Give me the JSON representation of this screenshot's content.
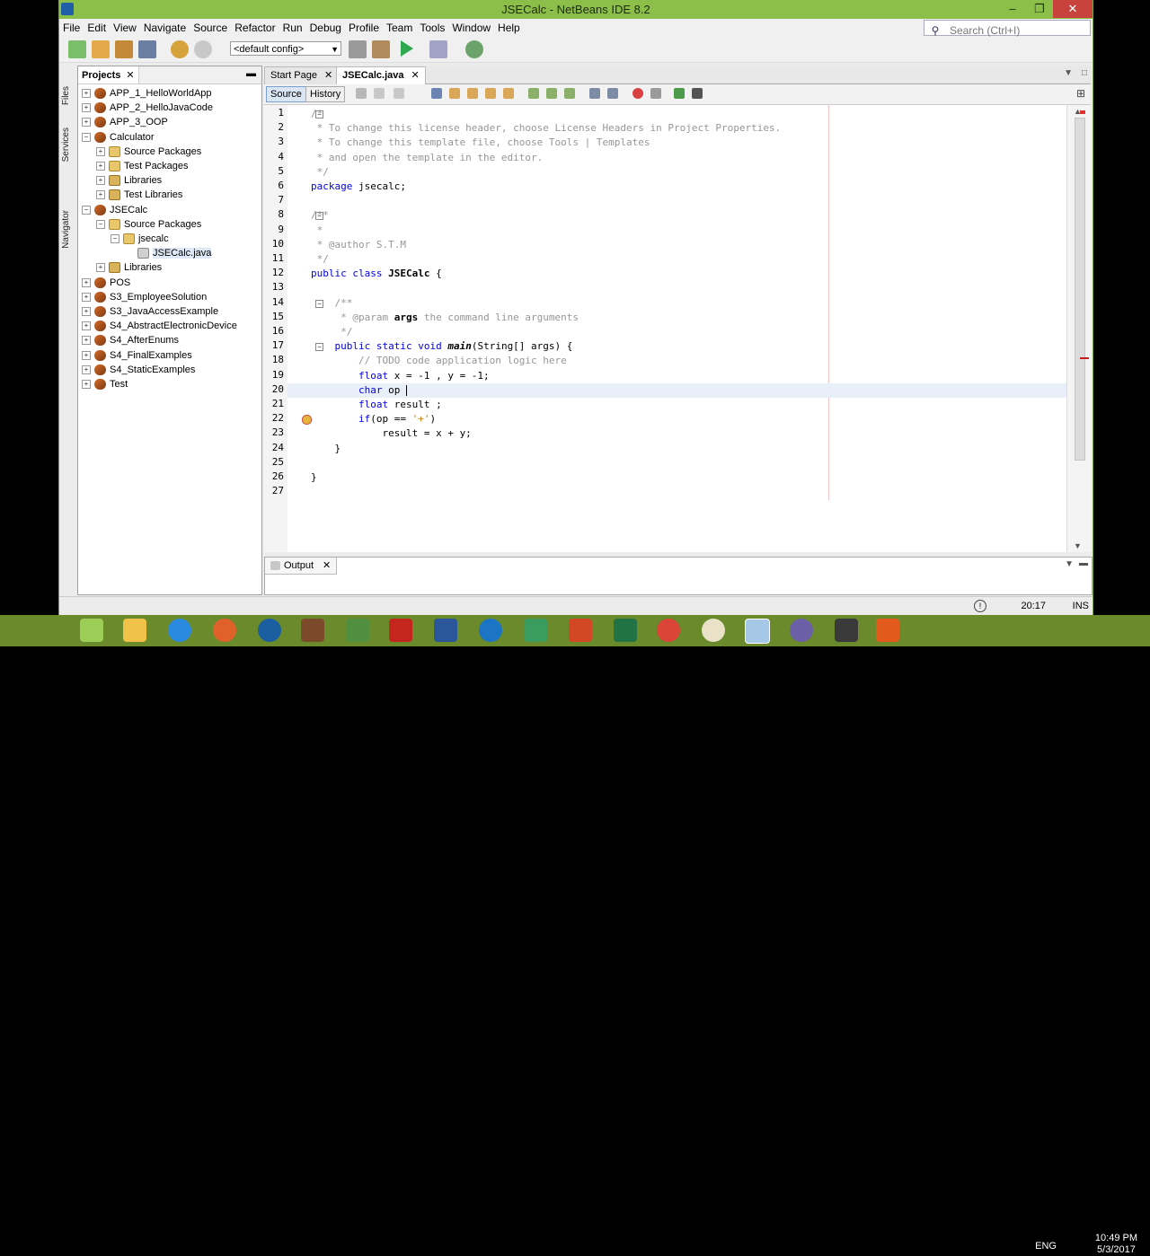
{
  "window": {
    "title": "JSECalc - NetBeans IDE 8.2",
    "controls": [
      "–",
      "❐",
      "✕"
    ]
  },
  "menu": {
    "items": [
      "File",
      "Edit",
      "View",
      "Navigate",
      "Source",
      "Refactor",
      "Run",
      "Debug",
      "Profile",
      "Team",
      "Tools",
      "Window",
      "Help"
    ],
    "search_placeholder": "Search (Ctrl+I)"
  },
  "toolbar": {
    "config_value": "<default config>"
  },
  "side_tabs": [
    "Files",
    "Services",
    "Navigator"
  ],
  "projects": {
    "tab_label": "Projects",
    "tree": [
      {
        "label": "APP_1_HelloWorldApp",
        "level": 0,
        "exp": "+",
        "icon": "proj"
      },
      {
        "label": "APP_2_HelloJavaCode",
        "level": 0,
        "exp": "+",
        "icon": "proj"
      },
      {
        "label": "APP_3_OOP",
        "level": 0,
        "exp": "+",
        "icon": "proj"
      },
      {
        "label": "Calculator",
        "level": 0,
        "exp": "−",
        "icon": "proj"
      },
      {
        "label": "Source Packages",
        "level": 1,
        "exp": "+",
        "icon": "pkg"
      },
      {
        "label": "Test Packages",
        "level": 1,
        "exp": "+",
        "icon": "pkg"
      },
      {
        "label": "Libraries",
        "level": 1,
        "exp": "+",
        "icon": "lib"
      },
      {
        "label": "Test Libraries",
        "level": 1,
        "exp": "+",
        "icon": "lib"
      },
      {
        "label": "JSECalc",
        "level": 0,
        "exp": "−",
        "icon": "proj"
      },
      {
        "label": "Source Packages",
        "level": 1,
        "exp": "−",
        "icon": "pkg"
      },
      {
        "label": "jsecalc",
        "level": 2,
        "exp": "−",
        "icon": "pkg"
      },
      {
        "label": "JSECalc.java",
        "level": 3,
        "exp": "",
        "icon": "java",
        "selected": true
      },
      {
        "label": "Libraries",
        "level": 1,
        "exp": "+",
        "icon": "lib"
      },
      {
        "label": "POS",
        "level": 0,
        "exp": "+",
        "icon": "proj"
      },
      {
        "label": "S3_EmployeeSolution",
        "level": 0,
        "exp": "+",
        "icon": "proj"
      },
      {
        "label": "S3_JavaAccessExample",
        "level": 0,
        "exp": "+",
        "icon": "proj"
      },
      {
        "label": "S4_AbstractElectronicDevice",
        "level": 0,
        "exp": "+",
        "icon": "proj"
      },
      {
        "label": "S4_AfterEnums",
        "level": 0,
        "exp": "+",
        "icon": "proj"
      },
      {
        "label": "S4_FinalExamples",
        "level": 0,
        "exp": "+",
        "icon": "proj"
      },
      {
        "label": "S4_StaticExamples",
        "level": 0,
        "exp": "+",
        "icon": "proj"
      },
      {
        "label": "Test",
        "level": 0,
        "exp": "+",
        "icon": "proj"
      }
    ]
  },
  "editor": {
    "tabs": [
      {
        "label": "Start Page",
        "active": false
      },
      {
        "label": "JSECalc.java",
        "active": true
      }
    ],
    "source_label": "Source",
    "history_label": "History",
    "lines": [
      {
        "n": "1",
        "fold": true,
        "parts": [
          {
            "t": "/*",
            "c": "cm"
          }
        ]
      },
      {
        "n": "2",
        "parts": [
          {
            "t": " * To change this license header, choose License Headers in Project Properties.",
            "c": "cm"
          }
        ]
      },
      {
        "n": "3",
        "parts": [
          {
            "t": " * To change this template file, choose Tools | Templates",
            "c": "cm"
          }
        ]
      },
      {
        "n": "4",
        "parts": [
          {
            "t": " * and open the template in the editor.",
            "c": "cm"
          }
        ]
      },
      {
        "n": "5",
        "parts": [
          {
            "t": " */",
            "c": "cm"
          }
        ]
      },
      {
        "n": "6",
        "parts": [
          {
            "t": "package",
            "c": "kw"
          },
          {
            "t": " jsecalc;",
            "c": ""
          }
        ]
      },
      {
        "n": "7",
        "parts": []
      },
      {
        "n": "8",
        "fold": true,
        "parts": [
          {
            "t": "/**",
            "c": "cm"
          }
        ]
      },
      {
        "n": "9",
        "parts": [
          {
            "t": " *",
            "c": "cm"
          }
        ]
      },
      {
        "n": "10",
        "parts": [
          {
            "t": " * @author S.T.M",
            "c": "cm"
          }
        ]
      },
      {
        "n": "11",
        "parts": [
          {
            "t": " */",
            "c": "cm"
          }
        ]
      },
      {
        "n": "12",
        "parts": [
          {
            "t": "public class",
            "c": "kw"
          },
          {
            "t": " ",
            "c": ""
          },
          {
            "t": "JSECalc",
            "c": "bold"
          },
          {
            "t": " {",
            "c": ""
          }
        ]
      },
      {
        "n": "13",
        "parts": []
      },
      {
        "n": "14",
        "fold": true,
        "parts": [
          {
            "t": "    /**",
            "c": "cm"
          }
        ]
      },
      {
        "n": "15",
        "parts": [
          {
            "t": "     * @param ",
            "c": "cm"
          },
          {
            "t": "args",
            "c": "bold"
          },
          {
            "t": " the command line arguments",
            "c": "cm"
          }
        ]
      },
      {
        "n": "16",
        "parts": [
          {
            "t": "     */",
            "c": "cm"
          }
        ]
      },
      {
        "n": "17",
        "fold": true,
        "parts": [
          {
            "t": "    public static void",
            "c": "kw"
          },
          {
            "t": " ",
            "c": ""
          },
          {
            "t": "main",
            "c": "bold it"
          },
          {
            "t": "(String[] args) {",
            "c": ""
          }
        ]
      },
      {
        "n": "18",
        "parts": [
          {
            "t": "        // TODO code application logic here",
            "c": "cm"
          }
        ]
      },
      {
        "n": "19",
        "parts": [
          {
            "t": "        float",
            "c": "kw"
          },
          {
            "t": " x = -1 , y = -1;",
            "c": ""
          }
        ]
      },
      {
        "n": "20",
        "caret": true,
        "parts": [
          {
            "t": "        char",
            "c": "kw"
          },
          {
            "t": " op ",
            "c": ""
          }
        ]
      },
      {
        "n": "21",
        "parts": [
          {
            "t": "        float",
            "c": "kw"
          },
          {
            "t": " result ;",
            "c": ""
          }
        ]
      },
      {
        "n": "22",
        "err": true,
        "parts": [
          {
            "t": "        if",
            "c": "kw"
          },
          {
            "t": "(op == ",
            "c": ""
          },
          {
            "t": "'+'",
            "c": "str"
          },
          {
            "t": ")",
            "c": ""
          }
        ]
      },
      {
        "n": "23",
        "parts": [
          {
            "t": "            result = x + y;",
            "c": ""
          }
        ]
      },
      {
        "n": "24",
        "parts": [
          {
            "t": "    }",
            "c": ""
          }
        ]
      },
      {
        "n": "25",
        "parts": []
      },
      {
        "n": "26",
        "parts": [
          {
            "t": "}",
            "c": ""
          }
        ]
      },
      {
        "n": "27",
        "parts": []
      }
    ]
  },
  "output": {
    "tab_label": "Output"
  },
  "status": {
    "position": "20:17",
    "mode": "INS"
  },
  "taskbar": {
    "lang": "ENG",
    "time": "10:49 PM",
    "date": "5/3/2017"
  },
  "colors": {
    "titlebar": "#8cbf4a",
    "keyword": "#0000e6",
    "comment": "#969696",
    "taskbar": "#6a8a2c"
  }
}
